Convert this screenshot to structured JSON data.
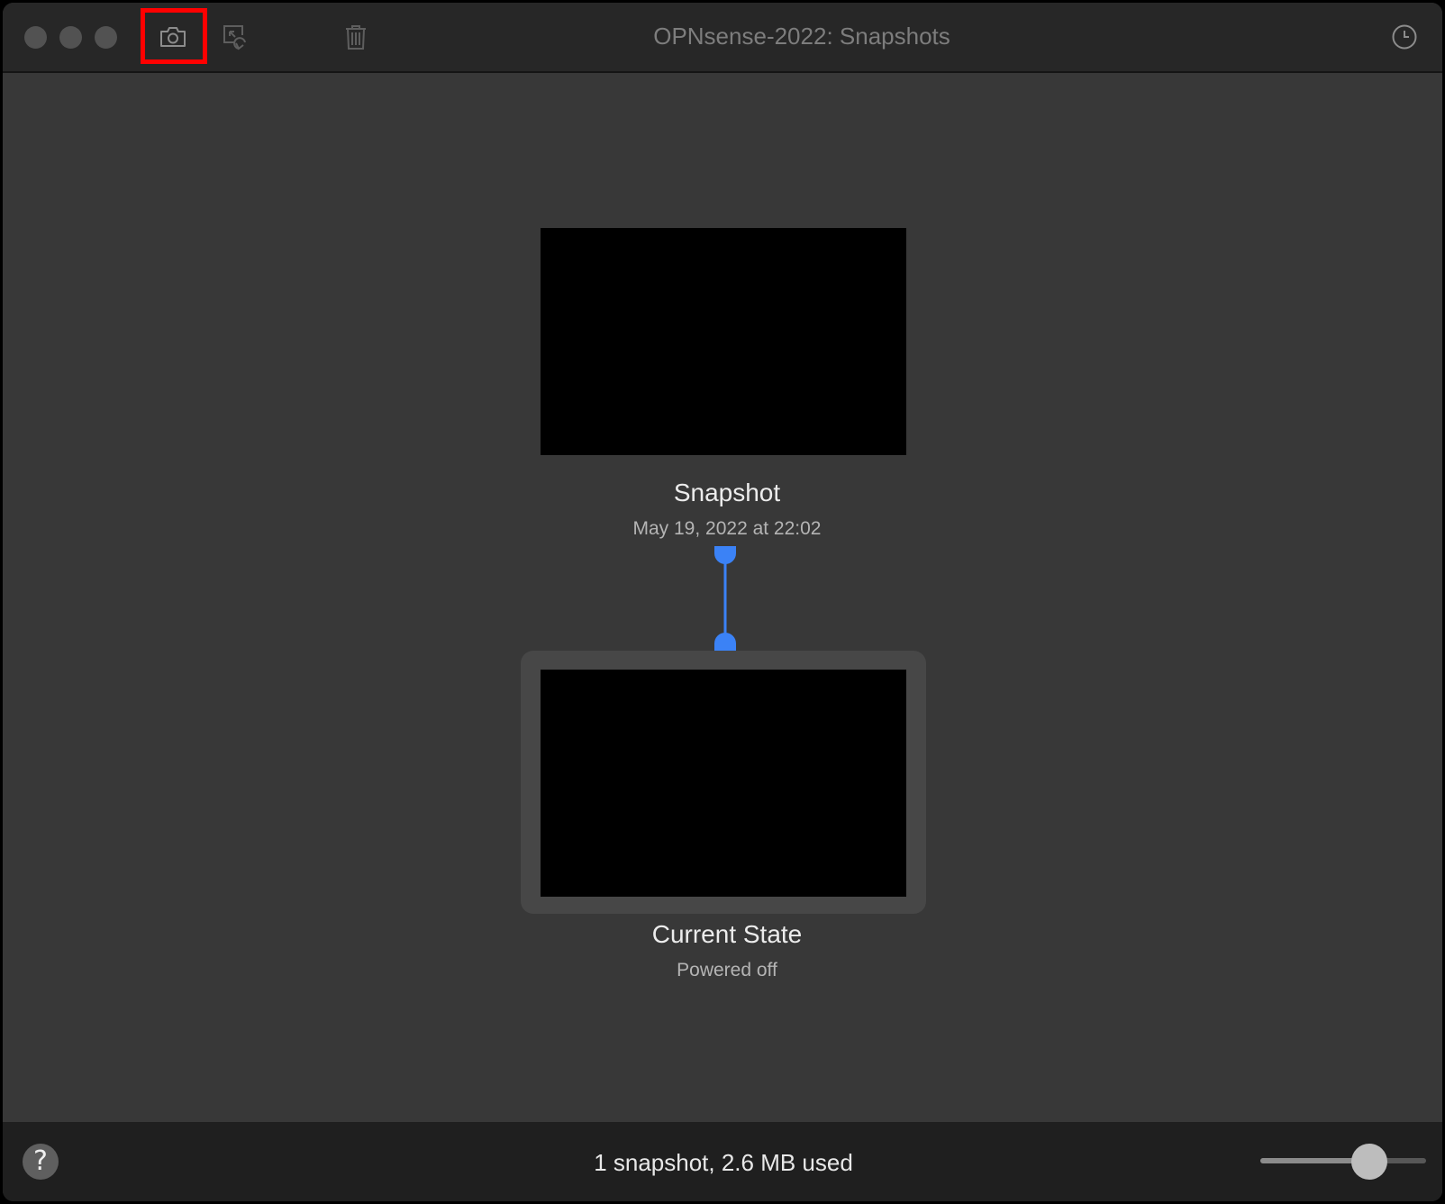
{
  "window": {
    "title": "OPNsense-2022: Snapshots"
  },
  "toolbar": {
    "take_snapshot_icon": "camera-icon",
    "restore_icon": "restore-snapshot-icon",
    "delete_icon": "trash-icon",
    "history_icon": "clock-icon"
  },
  "snapshots": [
    {
      "name": "Snapshot",
      "subtitle": "May 19, 2022 at 22:02"
    }
  ],
  "current_state": {
    "name": "Current State",
    "subtitle": "Powered off"
  },
  "footer": {
    "help_label": "?",
    "status": "1 snapshot, 2.6 MB used",
    "zoom_level": 0.66
  },
  "colors": {
    "accent": "#3b82f6",
    "highlight": "#ff0000"
  }
}
